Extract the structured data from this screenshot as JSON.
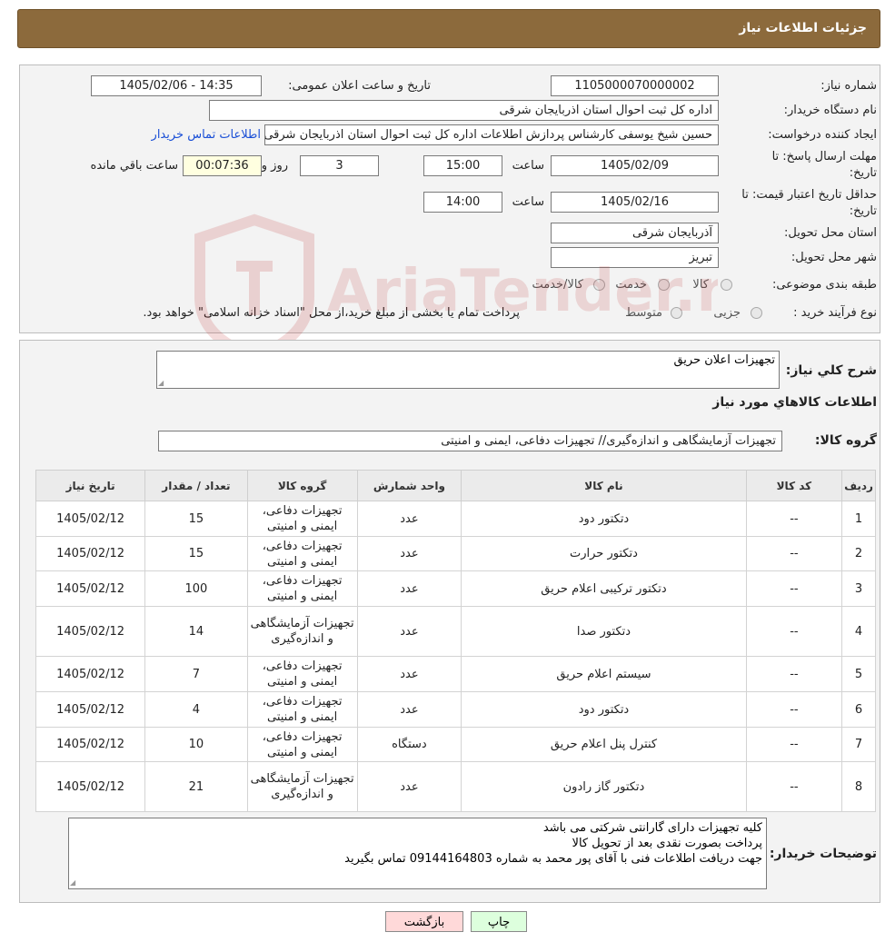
{
  "header": {
    "title": "جزئیات اطلاعات نیاز"
  },
  "general": {
    "need_number_label": "شماره نیاز:",
    "need_number": "1105000070000002",
    "announce_label": "تاریخ و ساعت اعلان عمومی:",
    "announce_value": "1405/02/06 - 14:35",
    "buyer_org_label": "نام دستگاه خریدار:",
    "buyer_org": "اداره کل ثبت احوال استان اذربایجان شرقی",
    "creator_label": "ایجاد کننده درخواست:",
    "creator": "حسین شیخ یوسفی کارشناس پردازش اطلاعات اداره کل ثبت احوال استان اذربایجان شرقی",
    "contact_link": "اطلاعات تماس خریدار",
    "reply_deadline_label_1": "مهلت ارسال پاسخ: تا",
    "reply_deadline_label_2": "تاریخ:",
    "reply_date": "1405/02/09",
    "time_label": "ساعت",
    "reply_time": "15:00",
    "days_value": "3",
    "days_label": "روز و",
    "remaining_time": "00:07:36",
    "remaining_label": "ساعت باقي مانده",
    "price_validity_label_1": "حداقل تاریخ اعتبار قیمت: تا",
    "price_validity_label_2": "تاریخ:",
    "price_date": "1405/02/16",
    "price_time": "14:00",
    "province_label": "استان محل تحویل:",
    "province": "آذربایجان شرقی",
    "city_label": "شهر محل تحویل:",
    "city": "تبریز",
    "category_label": "طبقه بندی موضوعی:",
    "category_options": [
      "کالا",
      "خدمت",
      "کالا/خدمت"
    ],
    "process_label": "نوع فرآیند خرید :",
    "process_options": [
      "جزیی",
      "متوسط"
    ],
    "process_note": "پرداخت تمام یا بخشی از مبلغ خرید،از محل \"اسناد خزانه اسلامی\" خواهد بود."
  },
  "description": {
    "summary_label": "شرح کلي نياز:",
    "summary": "تجهیزات اعلان حریق",
    "items_heading": "اطلاعات کالاهاي مورد نياز",
    "group_label": "گروه کالا:",
    "group_value": "تجهیزات آزمایشگاهی و اندازه‌گیری// تجهیزات دفاعی، ایمنی و امنیتی"
  },
  "table": {
    "headers": [
      "رديف",
      "کد کالا",
      "نام کالا",
      "واحد شمارش",
      "گروه کالا",
      "تعداد / مقدار",
      "تاریخ نیاز"
    ],
    "rows": [
      [
        "1",
        "--",
        "دتکتور دود",
        "عدد",
        "تجهیزات دفاعی، ایمنی و امنیتی",
        "15",
        "1405/02/12"
      ],
      [
        "2",
        "--",
        "دتکتور حرارت",
        "عدد",
        "تجهیزات دفاعی، ایمنی و امنیتی",
        "15",
        "1405/02/12"
      ],
      [
        "3",
        "--",
        "دتکتور ترکیبی اعلام حریق",
        "عدد",
        "تجهیزات دفاعی، ایمنی و امنیتی",
        "100",
        "1405/02/12"
      ],
      [
        "4",
        "--",
        "دتکتور صدا",
        "عدد",
        "تجهیزات آزمایشگاهی و اندازه‌گیری",
        "14",
        "1405/02/12"
      ],
      [
        "5",
        "--",
        "سیستم اعلام حریق",
        "عدد",
        "تجهیزات دفاعی، ایمنی و امنیتی",
        "7",
        "1405/02/12"
      ],
      [
        "6",
        "--",
        "دتکتور دود",
        "عدد",
        "تجهیزات دفاعی، ایمنی و امنیتی",
        "4",
        "1405/02/12"
      ],
      [
        "7",
        "--",
        "کنترل پنل اعلام حریق",
        "دستگاه",
        "تجهیزات دفاعی، ایمنی و امنیتی",
        "10",
        "1405/02/12"
      ],
      [
        "8",
        "--",
        "دتکتور گاز رادون",
        "عدد",
        "تجهیزات آزمایشگاهی و اندازه‌گیری",
        "21",
        "1405/02/12"
      ]
    ]
  },
  "buyer_notes": {
    "label": "توضیحات خریدار:",
    "text": "کلیه تجهیزات دارای گارانتی شرکتی می باشد\nپرداخت بصورت نقدی بعد از تحویل کالا\nجهت دریافت اطلاعات فنی با آقای پور محمد به شماره 09144164803 تماس بگیرید"
  },
  "buttons": {
    "print": "چاپ",
    "back": "بازگشت"
  },
  "watermark": {
    "text": "AriaTender.neT"
  },
  "colors": {
    "header": "#8c6a3c",
    "link": "#1a4fd6",
    "back_button": "#ffd9d9",
    "print_button": "#ddffdd"
  }
}
